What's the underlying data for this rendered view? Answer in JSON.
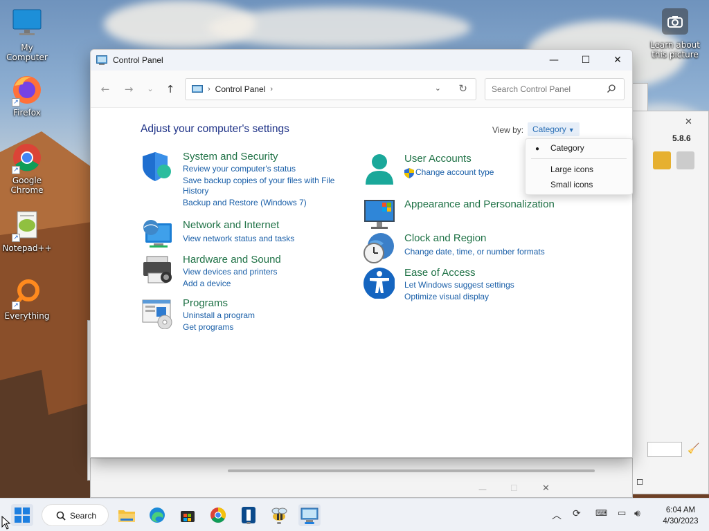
{
  "desktop": {
    "icons": [
      {
        "label": "My Computer"
      },
      {
        "label": "Firefox"
      },
      {
        "label": "Google Chrome"
      },
      {
        "label": "Notepad++"
      },
      {
        "label": "Everything"
      }
    ],
    "camera_label": "Learn about this picture"
  },
  "background_window": {
    "version": "5.8.6"
  },
  "window": {
    "title": "Control Panel",
    "controls": {
      "minimize": "—",
      "maximize": "☐",
      "close": "✕"
    },
    "address": {
      "segment": "Control Panel"
    },
    "search": {
      "placeholder": "Search Control Panel"
    },
    "heading": "Adjust your computer's settings",
    "view_by_label": "View by:",
    "view_by_value": "Category",
    "categories": [
      {
        "title": "System and Security",
        "links": [
          "Review your computer's status",
          "Save backup copies of your files with File",
          "History",
          "Backup and Restore (Windows 7)"
        ]
      },
      {
        "title": "Network and Internet",
        "links": [
          "View network status and tasks"
        ]
      },
      {
        "title": "Hardware and Sound",
        "links": [
          "View devices and printers",
          "Add a device"
        ]
      },
      {
        "title": "Programs",
        "links": [
          "Uninstall a program",
          "Get programs"
        ]
      },
      {
        "title": "User Accounts",
        "links": [
          "Change account type"
        ]
      },
      {
        "title": "Appearance and Personalization",
        "links": []
      },
      {
        "title": "Clock and Region",
        "links": [
          "Change date, time, or number formats"
        ]
      },
      {
        "title": "Ease of Access",
        "links": [
          "Let Windows suggest settings",
          "Optimize visual display"
        ]
      }
    ]
  },
  "view_dropdown": {
    "options": [
      "Category",
      "Large icons",
      "Small icons"
    ],
    "selected": "Category"
  },
  "taskbar": {
    "search_label": "Search",
    "time": "6:04 AM",
    "date": "4/30/2023"
  }
}
